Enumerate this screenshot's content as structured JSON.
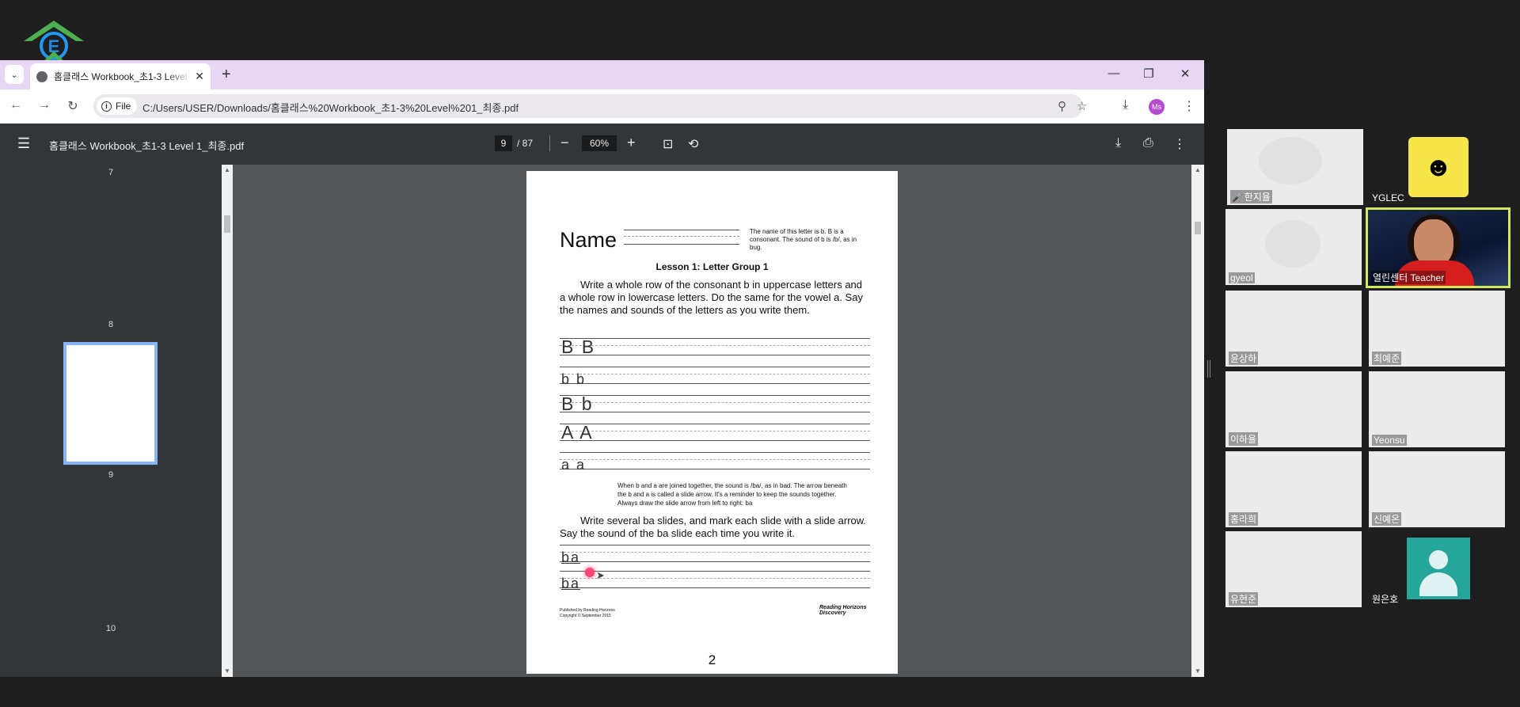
{
  "browser": {
    "tab_title": "홈클래스 Workbook_초1-3 Level 1_최종.pdf",
    "new_tab": "+",
    "url_chip": "File",
    "url": "C:/Users/USER/Downloads/홈클래스%20Workbook_초1-3%20Level%201_최종.pdf",
    "profile_initials": "Ms"
  },
  "pdf_toolbar": {
    "file_name": "홈클래스 Workbook_초1-3 Level 1_최종.pdf",
    "current_page": "9",
    "total_pages": "/ 87",
    "zoom": "60%"
  },
  "thumbnails": [
    "7",
    "8",
    "9",
    "10"
  ],
  "page": {
    "name_label": "Name",
    "note": "The name of this letter is b. B is a consonant. The sound of b is /b/, as in bug.",
    "lesson_title": "Lesson 1: Letter Group 1",
    "instruction1": "Write a whole row of the consonant b in uppercase letters and a whole row in lowercase letters. Do the same for the vowel a. Say the names and sounds of the letters as you write them.",
    "rows": [
      "B B",
      "b b",
      "B b",
      "A A",
      "a a"
    ],
    "small_note": "When b and a are joined together, the sound is /ba/, as in bad. The arrow beneath the b and a is called a slide arrow. It's a reminder to keep the sounds together. Always draw the slide arrow from left to right: ba",
    "instruction2": "Write several ba slides, and mark each slide with a slide arrow. Say the sound of the ba slide each time you write it.",
    "slide_rows": [
      "ba",
      "ba"
    ],
    "publisher": "Published by Reading Horizons\nCopyright © September 2015",
    "brand": "Reading Horizons Discovery",
    "page_number": "2"
  },
  "participants": [
    {
      "name": "한지율",
      "muted": true
    },
    {
      "name": "YGLEC"
    },
    {
      "name": "gyeol"
    },
    {
      "name": "열린센터 Teacher"
    },
    {
      "name": "윤상하"
    },
    {
      "name": "최예준"
    },
    {
      "name": "이하율"
    },
    {
      "name": "Yeonsu"
    },
    {
      "name": "홍라희"
    },
    {
      "name": "신예온"
    },
    {
      "name": "유현준"
    },
    {
      "name": "원은호"
    }
  ],
  "colors": {
    "tabbar": "#e8d6f5",
    "pdf_bg": "#525659",
    "toolbar": "#323639",
    "highlight": "#d3e85a",
    "avatar_bg": "#26a69a"
  }
}
